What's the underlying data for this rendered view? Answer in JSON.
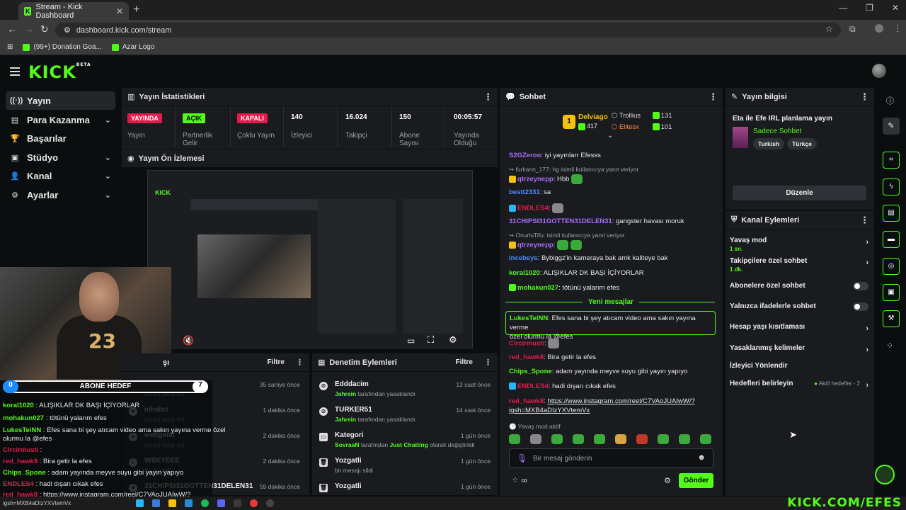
{
  "browser": {
    "tab_title": "Stream - Kick Dashboard",
    "url": "dashboard.kick.com/stream",
    "bookmarks": [
      "(99+) Donation Goa...",
      "Azar Logo"
    ]
  },
  "header": {
    "logo": "KICK",
    "logo_sup": "BETA"
  },
  "sidebar": {
    "items": [
      {
        "label": "Yayın",
        "icon": "((·))"
      },
      {
        "label": "Para Kazanma",
        "icon": "▤"
      },
      {
        "label": "Başarılar",
        "icon": "🏆"
      },
      {
        "label": "Stüdyo",
        "icon": "▣"
      },
      {
        "label": "Kanal",
        "icon": "👤"
      },
      {
        "label": "Ayarlar",
        "icon": "⚙"
      }
    ]
  },
  "stats": {
    "title": "Yayın İstatistikleri",
    "items": [
      {
        "value": "YAYINDA",
        "label": "Yayın"
      },
      {
        "value": "AÇIK",
        "label": "Partnerlik Gelir"
      },
      {
        "value": "KAPALI",
        "label": "Çoklu Yayın"
      },
      {
        "value": "140",
        "label": "İzleyici"
      },
      {
        "value": "16.024",
        "label": "Takipçi"
      },
      {
        "value": "150",
        "label": "Abone Sayısı"
      },
      {
        "value": "00:05:57",
        "label": "Yayında Olduğu"
      }
    ]
  },
  "preview": {
    "title": "Yayın Ön İzlemesi"
  },
  "overlay": {
    "sub_goal": "ABONE HEDEF",
    "sub_left": "0",
    "sub_right": "7",
    "lines": [
      {
        "user": "koral1020",
        "color": "#53fc18",
        "msg": "ALIŞIKLAR DK BAŞI İÇİYORLAR"
      },
      {
        "user": "mohakun027",
        "color": "#53fc18",
        "msg": "tötünü yalarım efes"
      },
      {
        "user": "LukesTeiNN",
        "color": "#53fc18",
        "msg": "Efes sana bi şey atıcam video ama sakın yayına verme özel"
      },
      {
        "user": "",
        "color": "#fff",
        "msg": "olurmu la @efes"
      },
      {
        "user": "Circirmusti",
        "color": "#e41a4b",
        "msg": ""
      },
      {
        "user": "red_hawk8",
        "color": "#e41a4b",
        "msg": "Bira getir la efes"
      },
      {
        "user": "Chips_Spone",
        "color": "#53fc18",
        "msg": "adam yayında meyve suyu gibi yayın yapıyo"
      },
      {
        "user": "ENDLES4",
        "color": "#e41a4b",
        "msg": "hadi dışarı cıkak efes"
      },
      {
        "user": "red_hawk8",
        "color": "#e41a4b",
        "msg": "https://www.instagram.com/reel/C7VAoJUAIwW/?"
      },
      {
        "user": "",
        "color": "#fff",
        "msg": "igsh=MXB4aDIzYXVtemVx"
      }
    ]
  },
  "activity": {
    "title": "şı",
    "filter": "Filtre",
    "rows": [
      {
        "name": "aks58",
        "sub": "kanalı takip etti",
        "time": "35 saniye önce"
      },
      {
        "name": "nihaloz",
        "sub": "kanalı takip etti",
        "time": "1 dakika önce"
      },
      {
        "name": "weltgeist",
        "sub": "kanalı takip etti",
        "time": "2 dakika önce"
      },
      {
        "name": "WSKYEEE",
        "sub": "Su lo aldı",
        "time": "2 dakika önce"
      },
      {
        "name": "31CHIPSI31GOTTEN31DELEN31",
        "sub": "",
        "time": "59 dakika önce"
      }
    ]
  },
  "moderation": {
    "title": "Denetim Eylemleri",
    "filter": "Filtre",
    "rows": [
      {
        "name": "Edddacim",
        "actor": "Jahrein",
        "action": "tarafından yasaklandı",
        "time": "13 saat önce"
      },
      {
        "name": "TURKER51",
        "actor": "Jahrein",
        "action": "tarafından yasaklandı",
        "time": "14 saat önce"
      },
      {
        "name": "Kategori",
        "actor": "SovraaN",
        "action": "tarafından",
        "extra": "Just Chatting",
        "extra2": "olarak değiştirildi",
        "time": "1 gün önce"
      },
      {
        "name": "Yozgatli",
        "actor": "",
        "action": "bir mesajı sildi",
        "time": "1 gün önce"
      },
      {
        "name": "Yozgatli",
        "actor": "",
        "action": "",
        "time": "1 gün önce"
      }
    ]
  },
  "chat": {
    "title": "Sohbet",
    "leaders": [
      {
        "rank": "1",
        "name": "Delviago",
        "count": "417"
      },
      {
        "name": "Trollius",
        "count": "131"
      },
      {
        "name": "Elitesx",
        "count": "101"
      }
    ],
    "messages": [
      {
        "user": "S2GZeroo",
        "color": "#a970ff",
        "msg": "iyi yayınlarr Efesss"
      },
      {
        "reply": "furkann_177: hg isimli kullanıcıya yanıt veriyor"
      },
      {
        "user": "qtrzeynepp",
        "color": "#a970ff",
        "msg": "Hbb"
      },
      {
        "user": "bestt2331",
        "color": "#4d8bff",
        "msg": "sa"
      },
      {
        "user": "ENDLES4",
        "color": "#e41a4b",
        "msg": ""
      },
      {
        "user": "31CHIPSI31GOTTEN31DELEN31",
        "color": "#a970ff",
        "msg": "gangster havası moruk"
      },
      {
        "reply": "OnurluTifu: isimli kullanıcıya yanıt veriyor"
      },
      {
        "user": "qtrzeynepp",
        "color": "#a970ff",
        "msg": ""
      },
      {
        "user": "incebeys",
        "color": "#4d8bff",
        "msg": "Bybiggz'in kameraya bak amk kaliteye bak"
      },
      {
        "user": "koral1020",
        "color": "#53fc18",
        "msg": "ALIŞIKLAR DK BAŞI İÇİYORLAR"
      },
      {
        "user": "mohakun027",
        "color": "#53fc18",
        "msg": "tötünü yalarım efes"
      }
    ],
    "new_messages": "Yeni mesajlar",
    "highlight_user": "LukesTeiNN",
    "highlight_msg": "Efes sana bi şey atıcam video ama sakın yayına verme",
    "highlight_msg2": "özel olurmu la @efes",
    "messages2": [
      {
        "user": "Circirmusti",
        "color": "#e41a4b",
        "msg": ""
      },
      {
        "user": "red_hawk8",
        "color": "#e41a4b",
        "msg": "Bira getir la efes"
      },
      {
        "user": "Chips_Spone",
        "color": "#53fc18",
        "msg": "adam yayında meyve suyu gibi yayın yapıyo"
      },
      {
        "user": "ENDLES4",
        "color": "#e41a4b",
        "msg": "hadi dışarı cıkak efes"
      },
      {
        "user": "red_hawk8",
        "color": "#e41a4b",
        "msg": "https://www.instagram.com/reel/C7VAoJUAIwW/?"
      }
    ],
    "link_cont": "igsh=MXB4aDIzYXVtemVx",
    "slow_mode": "Yavaş mod aktif",
    "input_placeholder": "Bir mesaj gönderin",
    "send": "Gönder"
  },
  "info": {
    "title": "Yayın bilgisi",
    "stream_title": "Eta ile Efe IRL planlama yayın",
    "category": "Sadece Sohbet",
    "tags": [
      "Turkish",
      "Türkçe"
    ],
    "edit": "Düzenle"
  },
  "channel": {
    "title": "Kanal Eylemleri",
    "rows": [
      {
        "label": "Yavaş mod",
        "sub": "1 sn.",
        "kind": "arrow"
      },
      {
        "label": "Takipçilere özel sohbet",
        "sub": "1 dk.",
        "kind": "arrow"
      },
      {
        "label": "Abonelere özel sohbet",
        "sub": "",
        "kind": "toggle"
      },
      {
        "label": "Yalnızca ifadelerle sohbet",
        "sub": "",
        "kind": "toggle"
      },
      {
        "label": "Hesap yaşı kısıtlaması",
        "sub": "",
        "kind": "arrow"
      },
      {
        "label": "Yasaklanmış kelimeler",
        "sub": "",
        "kind": "arrow"
      },
      {
        "label": "İzleyici Yönlendir",
        "sub": "",
        "kind": "none"
      },
      {
        "label": "Hedefleri belirleyin",
        "sub": "",
        "kind": "goal",
        "goal": "Aktif hedefler - 2"
      }
    ]
  },
  "watermark": "KICK.COM/EFES",
  "taskbar_text": "igsh=MXB4aDIzYXVtemVx"
}
